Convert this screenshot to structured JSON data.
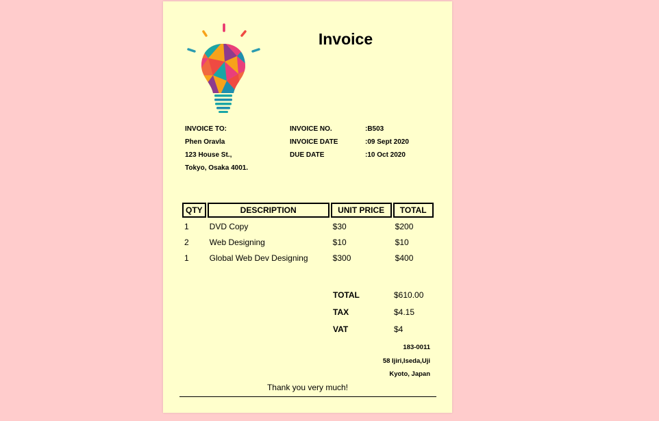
{
  "invoice": {
    "title": "Invoice",
    "logo_icon": "lightbulb-icon",
    "bill_to": {
      "heading": "INVOICE TO:",
      "name": "Phen Oravla",
      "street": "123 House St.,",
      "city": "Tokyo, Osaka 4001."
    },
    "details": {
      "labels": [
        "INVOICE NO.",
        "INVOICE DATE",
        "DUE DATE"
      ],
      "values": [
        ":B503",
        ":09 Sept 2020",
        ":10 Oct 2020"
      ]
    },
    "table": {
      "headers": [
        "QTY",
        "DESCRIPTION",
        "UNIT PRICE",
        "TOTAL"
      ],
      "rows": [
        [
          "1",
          "DVD Copy",
          "$30",
          "$200"
        ],
        [
          "2",
          "Web Designing",
          "$10",
          "$10"
        ],
        [
          "1",
          "Global Web Dev Designing",
          "$300",
          "$400"
        ]
      ]
    },
    "totals": [
      {
        "label": "TOTAL",
        "value": "$610.00"
      },
      {
        "label": "TAX",
        "value": "$4.15"
      },
      {
        "label": "VAT",
        "value": "$4"
      }
    ],
    "address": [
      "183-0011",
      "58 Ijiri,Iseda,Uji",
      "Kyoto, Japan"
    ],
    "thanks": "Thank you very much!"
  },
  "colors": {
    "page_background": "#ffcccc",
    "sheet_background": "#ffffcc"
  }
}
